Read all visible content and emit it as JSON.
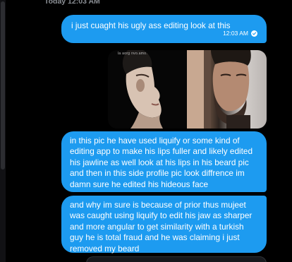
{
  "day_separator": "Today 12:03 AM",
  "messages": [
    {
      "text": "i just cuaght his ugly ass editing look at this",
      "time": "12:03 AM"
    },
    {
      "media_caption": "la aorg nvo.amo."
    },
    {
      "text": "in this pic he have used liquify or some kind of editing app to make his lips fuller and likely edited his jawline as well look at his lips in his beard pic and then in this side profile pic look diffrence im damn sure he edited his hideous face"
    },
    {
      "text": "and why im sure is because of prior thus mujeet was caught using liquify to edit his jaw as sharper and more angular to get similarity with a turkish guy he is total fraud and he was claiming i just removed my beard"
    }
  ],
  "colors": {
    "sent_bubble": "#1d9bf0",
    "background": "#000000",
    "timestamp_text": "#8b8f95"
  },
  "icons": {
    "sent_status": "check-circle-icon"
  }
}
